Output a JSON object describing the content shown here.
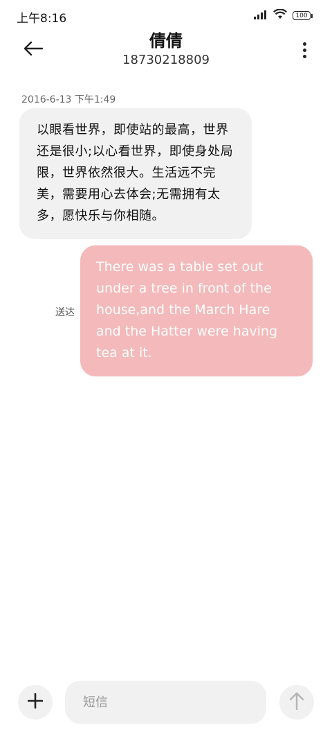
{
  "status_bar": {
    "time": "上午8:16",
    "battery": "100",
    "icons": [
      "signal-icon",
      "wifi-icon",
      "battery-icon"
    ]
  },
  "header": {
    "contact_name": "倩倩",
    "contact_number": "18730218809",
    "icons": [
      "back-arrow-icon",
      "more-vert-icon"
    ]
  },
  "conversation": {
    "timestamp": "2016-6-13 下午1:49",
    "messages": [
      {
        "direction": "incoming",
        "text": "以眼看世界，即使站的最高，世界还是很小;以心看世界，即使身处局限，世界依然很大。生活远不完美，需要用心去体会;无需拥有太多，愿快乐与你相随。"
      },
      {
        "direction": "outgoing",
        "status": "送达",
        "text": "There was a table set out under a tree in front of the house,and the March Hare and the Hatter were having tea at it."
      }
    ]
  },
  "composer": {
    "placeholder": "短信",
    "value": "",
    "icons": [
      "plus-icon",
      "send-arrow-icon"
    ]
  },
  "colors": {
    "outgoing_bubble": "#f4b9ba",
    "incoming_bubble": "#f1f1f1",
    "background": "#ffffff"
  }
}
